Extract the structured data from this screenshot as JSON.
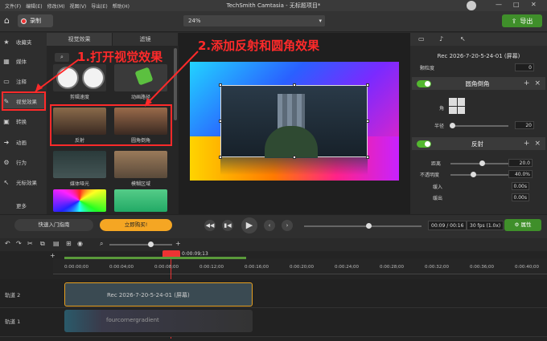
{
  "menu": [
    "文件(F)",
    "编辑(E)",
    "修改(M)",
    "视图(V)",
    "导出(E)",
    "帮助(H)"
  ],
  "window_title": "TechSmith Camtasia - 无标题项目*",
  "toolbar": {
    "record_label": "录制",
    "zoom": "24%",
    "export_label": "导出"
  },
  "nav": [
    {
      "icon": "star-icon",
      "label": "收藏夹"
    },
    {
      "icon": "media-icon",
      "label": "媒体"
    },
    {
      "icon": "annotation-icon",
      "label": "注释"
    },
    {
      "icon": "visual-effects-icon",
      "label": "视觉效果"
    },
    {
      "icon": "transition-icon",
      "label": "转换"
    },
    {
      "icon": "animation-icon",
      "label": "动画"
    },
    {
      "icon": "behavior-icon",
      "label": "行为"
    },
    {
      "icon": "cursor-effects-icon",
      "label": "光标效果"
    }
  ],
  "nav_more": "更多",
  "panel_tabs": [
    "视觉效果",
    "滤镜"
  ],
  "effects": [
    {
      "label": "剪辑速度"
    },
    {
      "label": "动画路径"
    },
    {
      "label": "反射"
    },
    {
      "label": "圆角倒角"
    },
    {
      "label": "媒体哑光"
    },
    {
      "label": "模糊区域"
    }
  ],
  "props": {
    "title": "Rec 2026-7-20-5-24-01 (屏幕)",
    "top_label": "颗粒度",
    "top_value": "0",
    "rounded": {
      "title": "圆角倒角",
      "corner_label": "角",
      "radius_label": "半径",
      "radius_value": "20"
    },
    "reflection": {
      "title": "反射",
      "distance_label": "距离",
      "distance_value": "20.0",
      "opacity_label": "不透明度",
      "opacity_value": "40.0%",
      "fadein_label": "缓入",
      "fadein_value": "0.00s",
      "fadeout_label": "缓出",
      "fadeout_value": "0.00s"
    }
  },
  "playback": {
    "guide_label": "快速入门指南",
    "buy_label": "立即购买!",
    "time": "00:09 / 00:16",
    "fps": "30 fps (1.0x)",
    "props_label": "属性"
  },
  "timeline": {
    "playhead": "0:00:09;13",
    "ticks": [
      "0:00:00;00",
      "0:00:04;00",
      "0:00:08;00",
      "0:00:12;00",
      "0:00:16;00",
      "0:00:20;00",
      "0:00:24;00",
      "0:00:28;00",
      "0:00:32;00",
      "0:00:36;00",
      "0:00:40;00"
    ],
    "tracks": [
      {
        "name": "轨道 2",
        "clip": "Rec 2026-7-20-5-24-01 (屏幕)"
      },
      {
        "name": "轨道 1",
        "clip": "fourcornergradient"
      }
    ]
  },
  "annotations": {
    "step1": "1.打开视觉效果",
    "step2": "2.添加反射和圆角效果"
  },
  "colors": {
    "accent_green": "#3f8f2a",
    "annotation_red": "#ff2a2a",
    "buy_orange": "#f5a623"
  }
}
